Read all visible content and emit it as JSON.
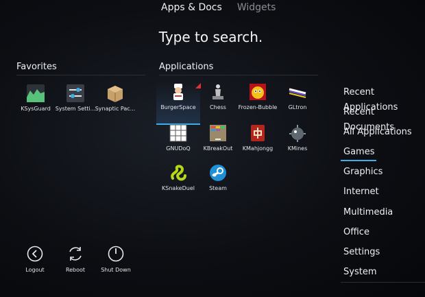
{
  "tabs": [
    {
      "label": "Apps & Docs",
      "active": true
    },
    {
      "label": "Widgets",
      "active": false
    }
  ],
  "search": {
    "prompt": "Type to search."
  },
  "favorites": {
    "title": "Favorites",
    "items": [
      {
        "label": "KSysGuard",
        "icon": "ksysguard-icon"
      },
      {
        "label": "System Setti...",
        "icon": "system-settings-icon"
      },
      {
        "label": "Synaptic Pac...",
        "icon": "synaptic-package-icon"
      }
    ]
  },
  "applications": {
    "title": "Applications",
    "items": [
      {
        "label": "BurgerSpace",
        "icon": "burgerspace-icon",
        "selected": true
      },
      {
        "label": "Chess",
        "icon": "chess-icon"
      },
      {
        "label": "Frozen-Bubble",
        "icon": "frozen-bubble-icon"
      },
      {
        "label": "GLtron",
        "icon": "gltron-icon"
      },
      {
        "label": "GNUDoQ",
        "icon": "gnudoq-icon"
      },
      {
        "label": "KBreakOut",
        "icon": "kbreakout-icon"
      },
      {
        "label": "KMahjongg",
        "icon": "kmahjongg-icon"
      },
      {
        "label": "KMines",
        "icon": "kmines-icon"
      },
      {
        "label": "KSnakeDuel",
        "icon": "ksnakeduel-icon"
      },
      {
        "label": "Steam",
        "icon": "steam-icon"
      }
    ]
  },
  "power": [
    {
      "label": "Logout",
      "icon": "logout-icon"
    },
    {
      "label": "Reboot",
      "icon": "reboot-icon"
    },
    {
      "label": "Shut Down",
      "icon": "shutdown-icon"
    }
  ],
  "categories": [
    {
      "label": "Recent Applications"
    },
    {
      "label": "Recent Documents"
    },
    {
      "label": "All Applications"
    },
    {
      "label": "Games",
      "active": true
    },
    {
      "label": "Graphics"
    },
    {
      "label": "Internet"
    },
    {
      "label": "Multimedia"
    },
    {
      "label": "Office"
    },
    {
      "label": "Settings"
    },
    {
      "label": "System"
    }
  ],
  "colors": {
    "accent": "#3daee9",
    "background": "#0c0e13"
  }
}
